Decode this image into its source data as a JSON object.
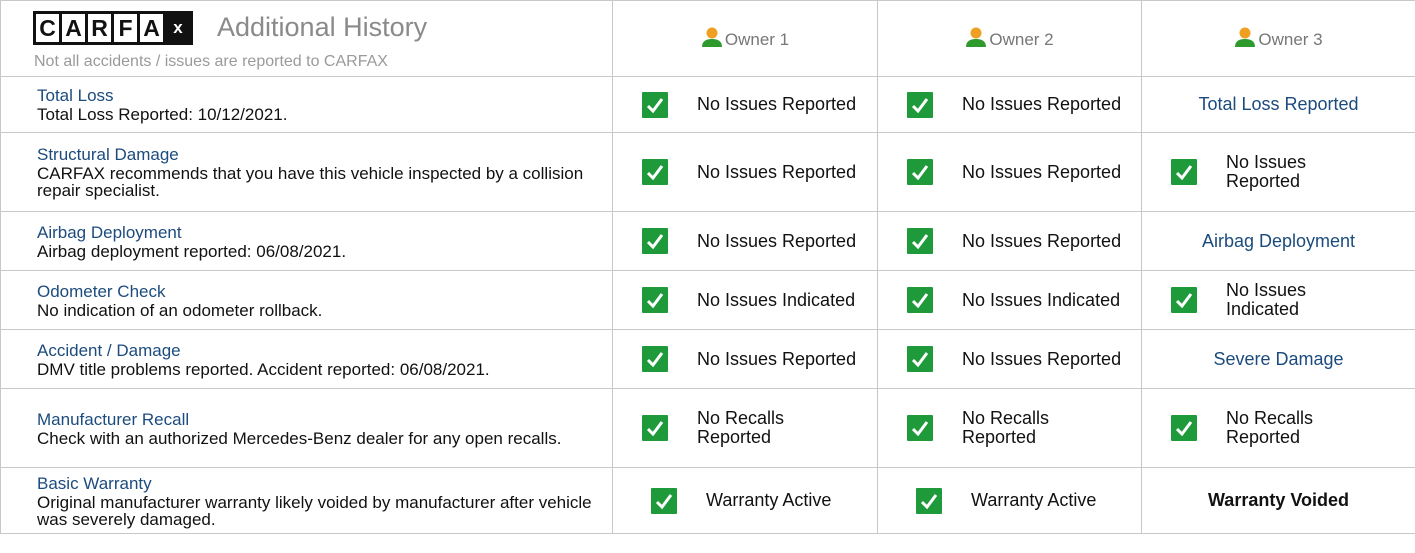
{
  "header": {
    "logo_letters": [
      "C",
      "A",
      "R",
      "F",
      "A",
      "x"
    ],
    "title": "Additional History",
    "subtitle": "Not all accidents / issues are reported to CARFAX",
    "owners": [
      "Owner 1",
      "Owner 2",
      "Owner 3"
    ]
  },
  "rows": [
    {
      "title": "Total Loss",
      "desc": "Total Loss Reported: 10/12/2021.",
      "owners": [
        {
          "text": "No Issues Reported",
          "check": true
        },
        {
          "text": "No Issues Reported",
          "check": true
        },
        {
          "text": "Total Loss Reported",
          "check": false
        }
      ]
    },
    {
      "title": "Structural Damage",
      "desc": "CARFAX recommends that you have this vehicle inspected by a collision repair specialist.",
      "owners": [
        {
          "text": "No Issues Reported",
          "check": true
        },
        {
          "text": "No Issues Reported",
          "check": true
        },
        {
          "text": "No Issues Reported",
          "check": true
        }
      ]
    },
    {
      "title": "Airbag Deployment",
      "desc": "Airbag deployment reported: 06/08/2021.",
      "owners": [
        {
          "text": "No Issues Reported",
          "check": true
        },
        {
          "text": "No Issues Reported",
          "check": true
        },
        {
          "text": "Airbag Deployment",
          "check": false
        }
      ]
    },
    {
      "title": "Odometer Check",
      "desc": "No indication of an odometer rollback.",
      "owners": [
        {
          "text": "No Issues Indicated",
          "check": true
        },
        {
          "text": "No Issues Indicated",
          "check": true
        },
        {
          "text": "No Issues Indicated",
          "check": true
        }
      ]
    },
    {
      "title": "Accident / Damage",
      "desc": "DMV title problems reported. Accident reported: 06/08/2021.",
      "owners": [
        {
          "text": "No Issues Reported",
          "check": true
        },
        {
          "text": "No Issues Reported",
          "check": true
        },
        {
          "text": "Severe Damage",
          "check": false
        }
      ]
    },
    {
      "title": "Manufacturer Recall",
      "desc": "Check with an authorized Mercedes-Benz dealer for any open recalls.",
      "owners": [
        {
          "text": "No Recalls Reported",
          "check": true
        },
        {
          "text": "No Recalls Reported",
          "check": true
        },
        {
          "text": "No Recalls Reported",
          "check": true
        }
      ]
    },
    {
      "title": "Basic Warranty",
      "desc": "Original manufacturer warranty likely voided by manufacturer after vehicle was severely damaged.",
      "owners": [
        {
          "text": "Warranty Active",
          "check": true
        },
        {
          "text": "Warranty Active",
          "check": true
        },
        {
          "text": "Warranty Voided",
          "check": false
        }
      ]
    }
  ],
  "colors": {
    "check_green": "#1f9a3b",
    "link_blue": "#1c4b7d",
    "border": "#c8c8c8",
    "owner_icon_orange": "#f0a020",
    "owner_icon_green": "#2e9a2e"
  },
  "icons": {
    "check": "checkmark-icon",
    "owner": "person-icon"
  }
}
